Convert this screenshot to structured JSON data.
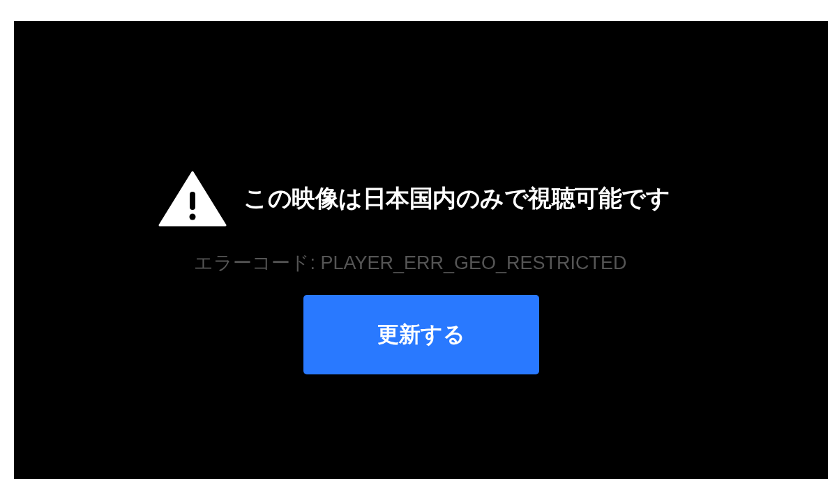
{
  "player_error": {
    "message": "この映像は日本国内のみで視聴可能です",
    "error_code": "エラーコード: PLAYER_ERR_GEO_RESTRICTED",
    "button": "更新する"
  }
}
